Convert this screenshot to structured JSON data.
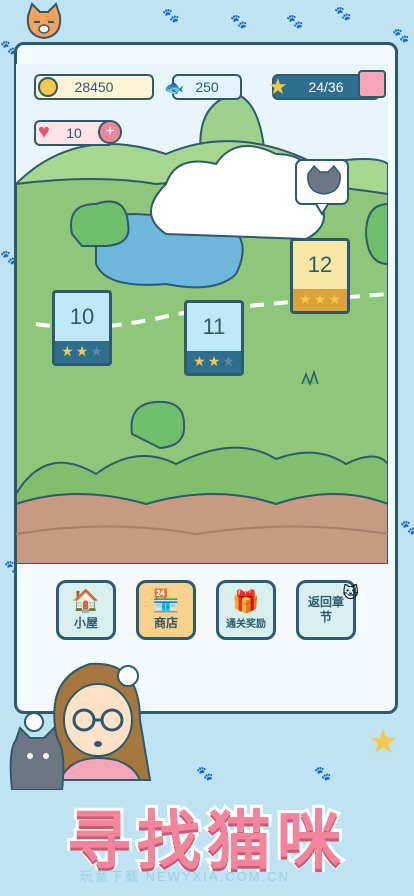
{
  "hud": {
    "coins": "28450",
    "fish": "250",
    "stars_progress": "24/36",
    "lives": "10"
  },
  "levels": [
    {
      "number": "10",
      "stars": "★★★"
    },
    {
      "number": "11",
      "stars": "★★★"
    },
    {
      "number": "12",
      "stars": "★★★"
    }
  ],
  "menu": {
    "house_label": "小屋",
    "shop_label": "商店",
    "reward_label": "通关奖励",
    "back_label": "返回章节"
  },
  "banner": {
    "title": "寻找猫咪",
    "watermark": "玩意下载 NEWYXIA.COM.CN"
  },
  "colors": {
    "background": "#bfe3f2",
    "grass": "#8fc77a",
    "dirt": "#c79a82",
    "title_pink": "#f2849b"
  }
}
